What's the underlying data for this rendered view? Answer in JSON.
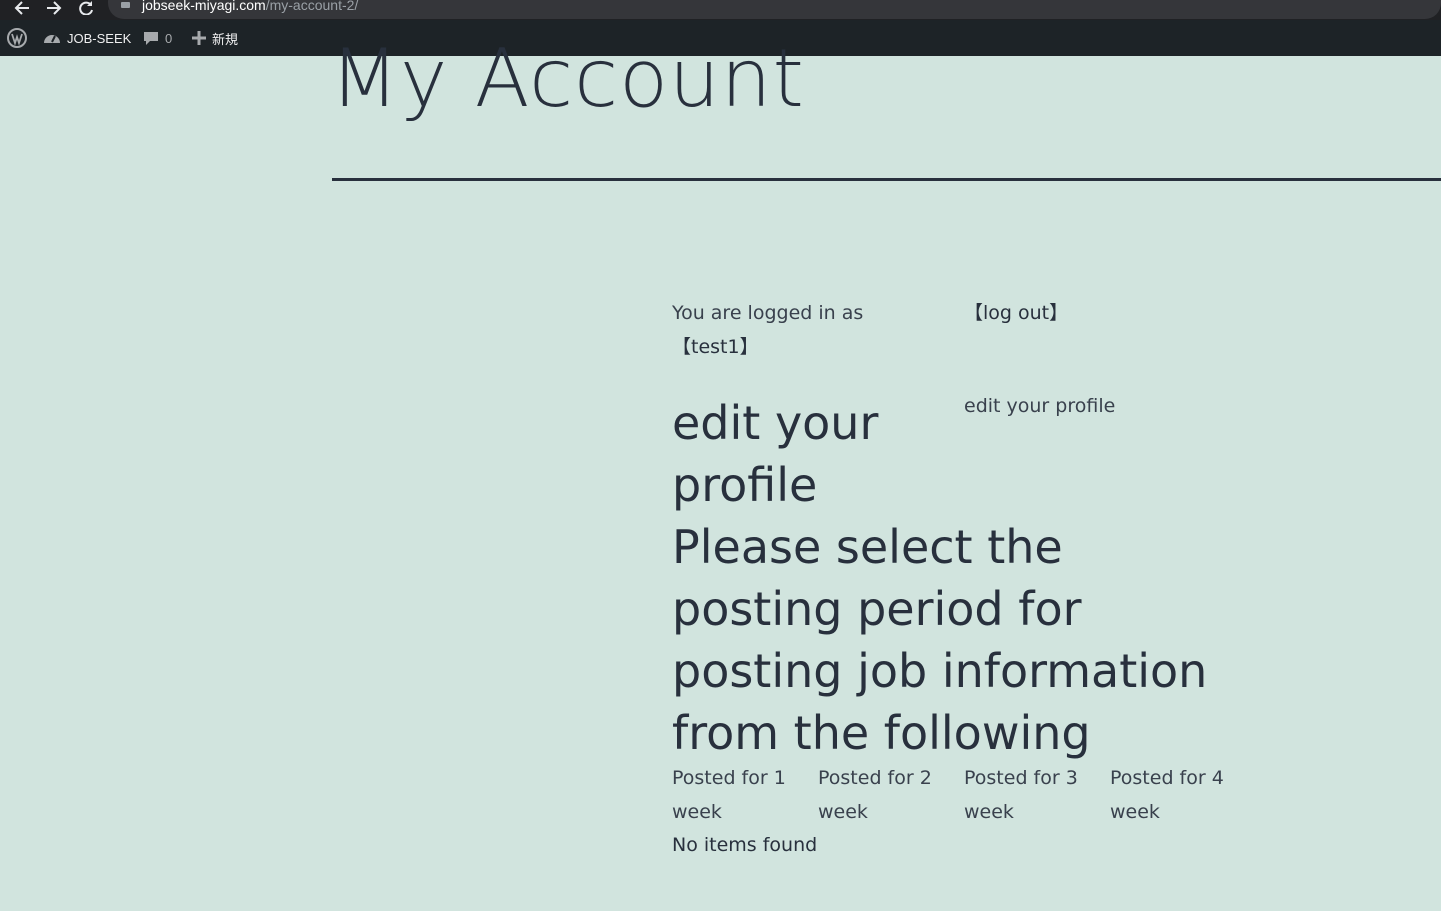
{
  "browser": {
    "url_host": "jobseek-miyagi.com",
    "url_path": "/my-account-2/"
  },
  "admin_bar": {
    "site_name": "JOB-SEEK",
    "comments_count": "0",
    "new_label": "新規"
  },
  "page": {
    "title": "My Account"
  },
  "account": {
    "logged_in_text": "You are logged in as",
    "username": "【test1】",
    "logout_label": "【log out】",
    "edit_profile_link": "edit your profile",
    "edit_profile_heading": "edit your profile",
    "posting_heading": "Please select the posting period for posting job information from the following",
    "posting_options": [
      "Posted for 1 week",
      "Posted for 2 week",
      "Posted for 3 week",
      "Posted for 4 week"
    ],
    "no_items": "No items found"
  },
  "colors": {
    "background": "#d1e4de",
    "text": "#28303d",
    "admin_bar": "#1d2327",
    "browser_bar": "#202124"
  }
}
